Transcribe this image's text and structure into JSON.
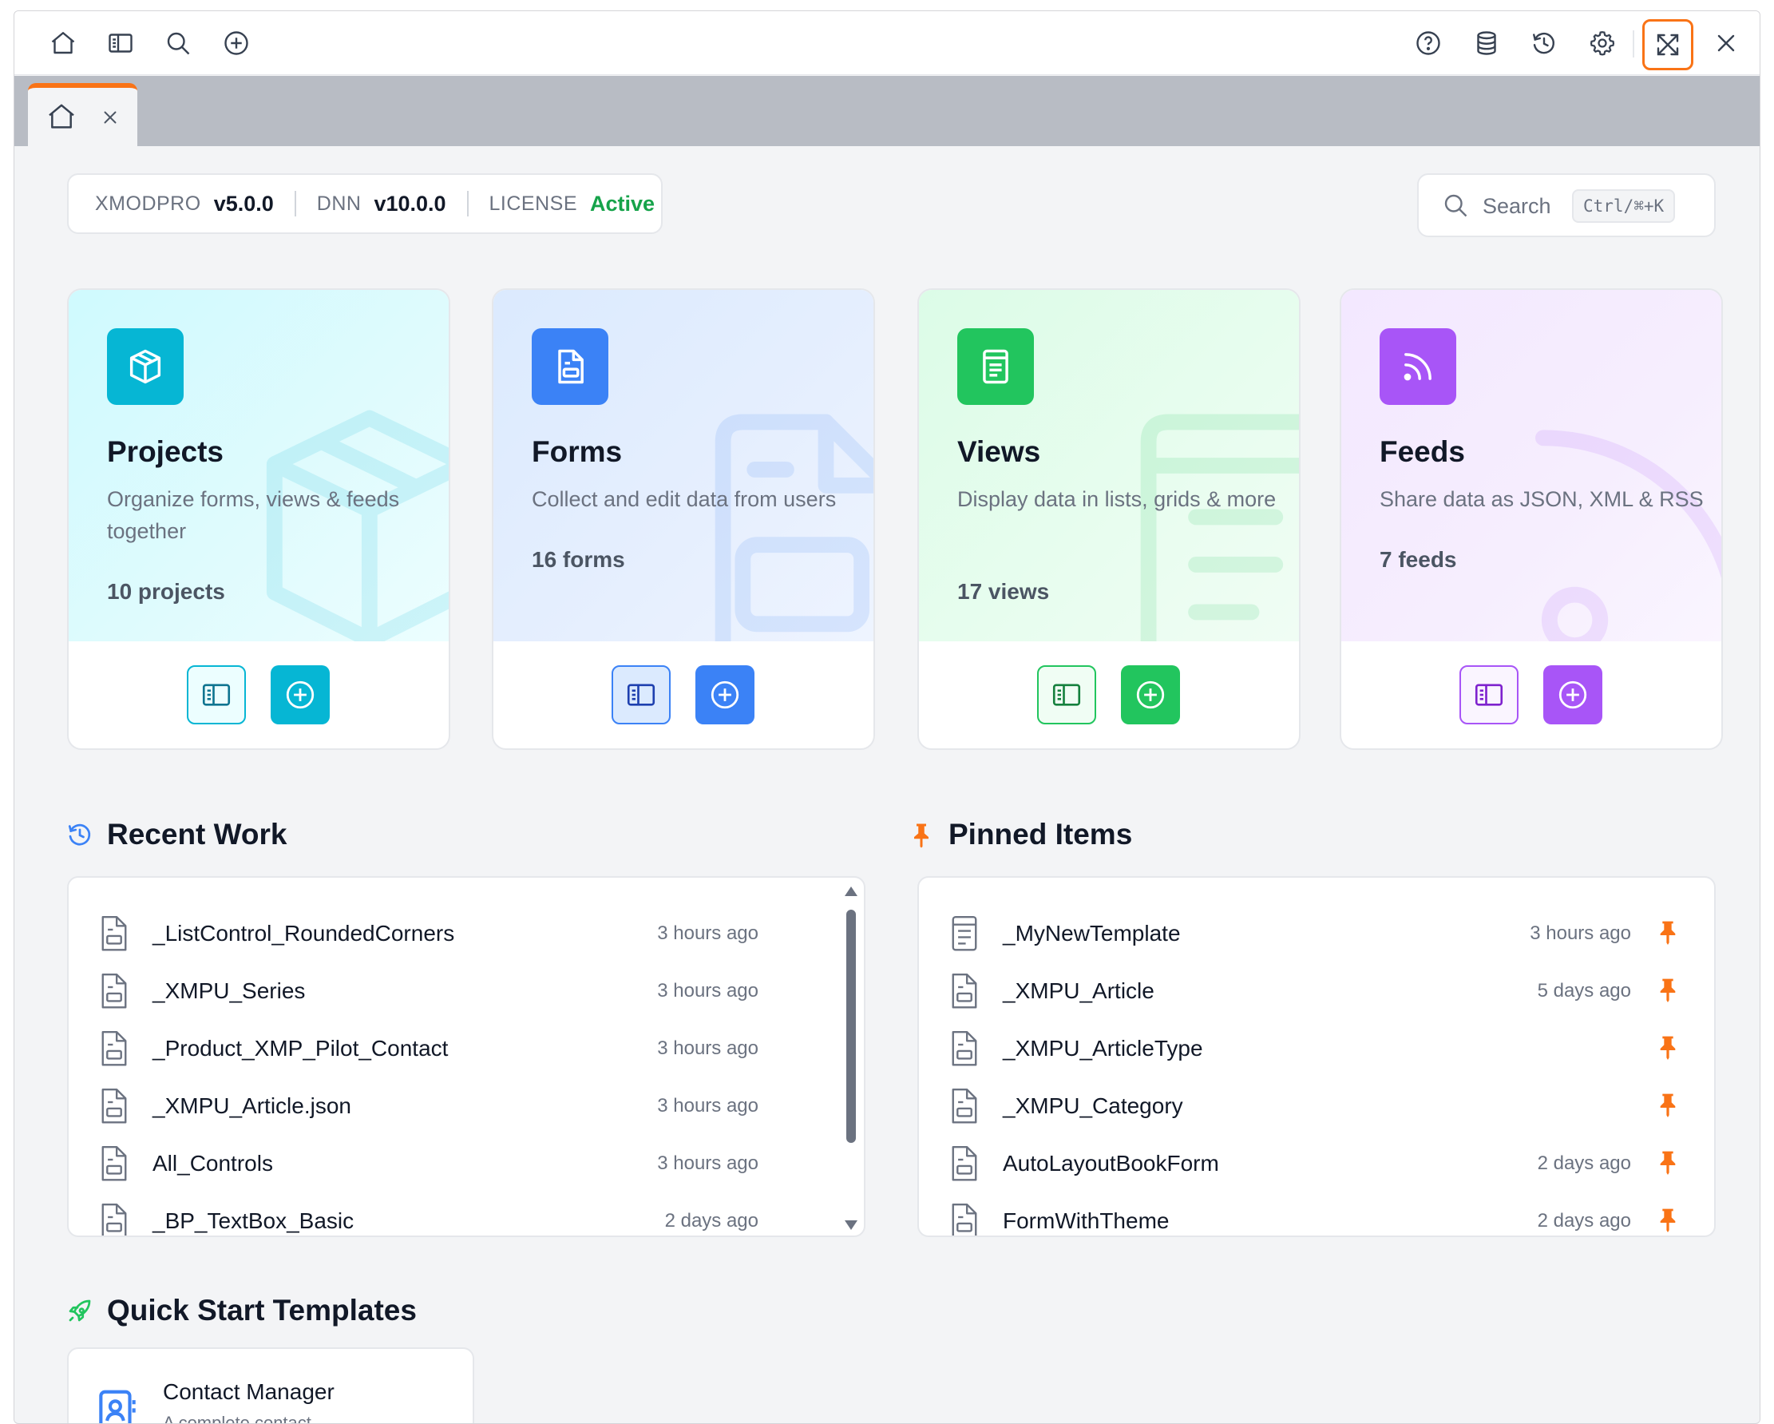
{
  "toolbar": {
    "left_icons": [
      "home-icon",
      "panel-icon",
      "search-icon",
      "add-circle-icon"
    ],
    "right_icons": [
      "help-icon",
      "database-icon",
      "history-icon",
      "gear-icon",
      "expand-icon",
      "close-icon"
    ],
    "active_button": "expand-icon"
  },
  "tabs": [
    {
      "icon": "home-icon",
      "active": true
    }
  ],
  "info": {
    "product_label": "XMODPRO",
    "product_version": "v5.0.0",
    "platform_label": "DNN",
    "platform_version": "v10.0.0",
    "license_label": "LICENSE",
    "license_status": "Active"
  },
  "search": {
    "placeholder": "Search",
    "shortcut": "Ctrl/⌘+K"
  },
  "cards": {
    "projects": {
      "title": "Projects",
      "description": "Organize forms, views & feeds together",
      "count": "10 projects",
      "accent": "#06b6d4"
    },
    "forms": {
      "title": "Forms",
      "description": "Collect and edit data from users",
      "count": "16 forms",
      "accent": "#3b82f6"
    },
    "views": {
      "title": "Views",
      "description": "Display data in lists, grids & more",
      "count": "17 views",
      "accent": "#22c55e"
    },
    "feeds": {
      "title": "Feeds",
      "description": "Share data as JSON, XML & RSS",
      "count": "7 feeds",
      "accent": "#a855f7"
    }
  },
  "recent": {
    "title": "Recent Work",
    "items": [
      {
        "name": "_ListControl_RoundedCorners",
        "time": "3 hours ago"
      },
      {
        "name": "_XMPU_Series",
        "time": "3 hours ago"
      },
      {
        "name": "_Product_XMP_Pilot_Contact",
        "time": "3 hours ago"
      },
      {
        "name": "_XMPU_Article.json",
        "time": "3 hours ago"
      },
      {
        "name": "All_Controls",
        "time": "3 hours ago"
      },
      {
        "name": "_BP_TextBox_Basic",
        "time": "2 days ago"
      }
    ]
  },
  "pinned": {
    "title": "Pinned Items",
    "items": [
      {
        "name": "_MyNewTemplate",
        "time": "3 hours ago",
        "icon": "view-file-icon"
      },
      {
        "name": "_XMPU_Article",
        "time": "5 days ago",
        "icon": "form-file-icon"
      },
      {
        "name": "_XMPU_ArticleType",
        "time": "",
        "icon": "form-file-icon"
      },
      {
        "name": "_XMPU_Category",
        "time": "",
        "icon": "form-file-icon"
      },
      {
        "name": "AutoLayoutBookForm",
        "time": "2 days ago",
        "icon": "form-file-icon"
      },
      {
        "name": "FormWithTheme",
        "time": "2 days ago",
        "icon": "form-file-icon"
      }
    ]
  },
  "templates": {
    "title": "Quick Start Templates",
    "items": [
      {
        "name": "Contact Manager",
        "description": "A complete contact"
      }
    ]
  },
  "colors": {
    "accent_orange": "#f97316",
    "active_green": "#16a34a",
    "recent_icon": "#3b82f6",
    "template_icon": "#22c55e"
  }
}
